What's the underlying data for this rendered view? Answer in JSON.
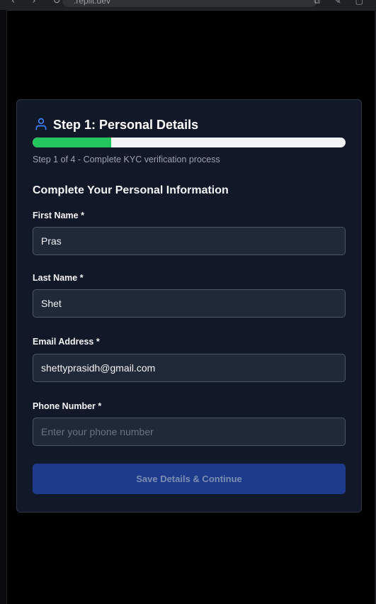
{
  "browser": {
    "url": ".replit.dev",
    "nav_glyphs": "‹ › ↻",
    "right_glyphs": "⧉ ✎ ▢"
  },
  "step": {
    "title": "Step 1: Personal Details",
    "icon": "user-icon",
    "progress_fraction": 0.25,
    "progress_text": "Step 1 of 4 - Complete KYC verification process"
  },
  "form": {
    "heading": "Complete Your Personal Information",
    "fields": [
      {
        "label": "First Name *",
        "value": "Pras",
        "placeholder": ""
      },
      {
        "label": "Last Name *",
        "value": "Shet",
        "placeholder": ""
      },
      {
        "label": "Email Address *",
        "value": "shettyprasidh@gmail.com",
        "placeholder": ""
      },
      {
        "label": "Phone Number *",
        "value": "",
        "placeholder": "Enter your phone number"
      }
    ],
    "submit_label": "Save Details & Continue"
  },
  "colors": {
    "page_bg": "#000000",
    "card_bg": "#111827",
    "accent_blue": "#3b82f6",
    "progress_green": "#22c55e",
    "button_bg": "#1e3a8a"
  }
}
